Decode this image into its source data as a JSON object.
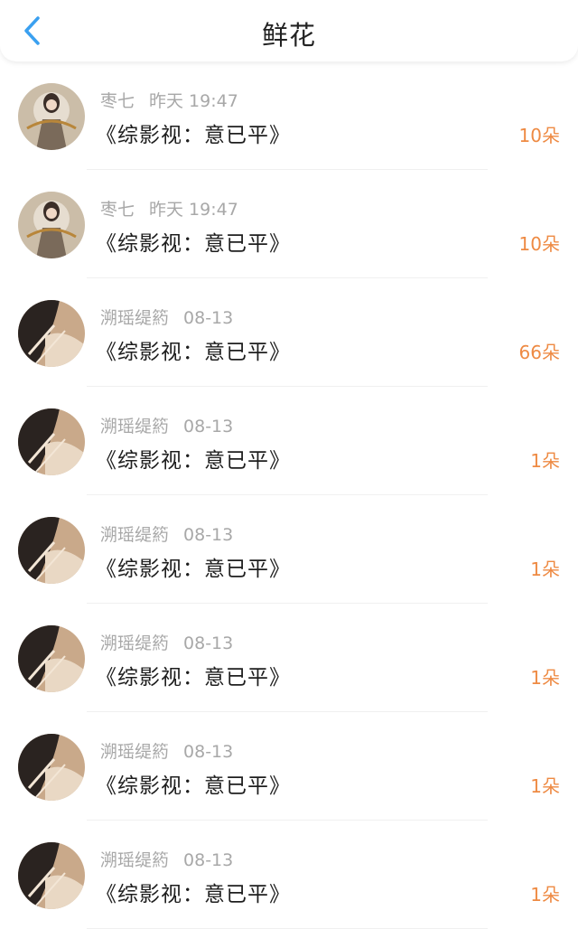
{
  "header": {
    "title": "鲜花",
    "back_icon": "chevron-left-icon",
    "accent_color": "#3aa0f0"
  },
  "count_color": "#ee8a43",
  "items": [
    {
      "user": "枣七",
      "time": "昨天 19:47",
      "book": "《综影视：意已平》",
      "count": "10朵",
      "avatar": "avatar-a"
    },
    {
      "user": "枣七",
      "time": "昨天 19:47",
      "book": "《综影视：意已平》",
      "count": "10朵",
      "avatar": "avatar-a"
    },
    {
      "user": "溯瑶缇箹",
      "time": "08-13",
      "book": "《综影视：意已平》",
      "count": "66朵",
      "avatar": "avatar-b"
    },
    {
      "user": "溯瑶缇箹",
      "time": "08-13",
      "book": "《综影视：意已平》",
      "count": "1朵",
      "avatar": "avatar-b"
    },
    {
      "user": "溯瑶缇箹",
      "time": "08-13",
      "book": "《综影视：意已平》",
      "count": "1朵",
      "avatar": "avatar-b"
    },
    {
      "user": "溯瑶缇箹",
      "time": "08-13",
      "book": "《综影视：意已平》",
      "count": "1朵",
      "avatar": "avatar-b"
    },
    {
      "user": "溯瑶缇箹",
      "time": "08-13",
      "book": "《综影视：意已平》",
      "count": "1朵",
      "avatar": "avatar-b"
    },
    {
      "user": "溯瑶缇箹",
      "time": "08-13",
      "book": "《综影视：意已平》",
      "count": "1朵",
      "avatar": "avatar-b"
    }
  ]
}
